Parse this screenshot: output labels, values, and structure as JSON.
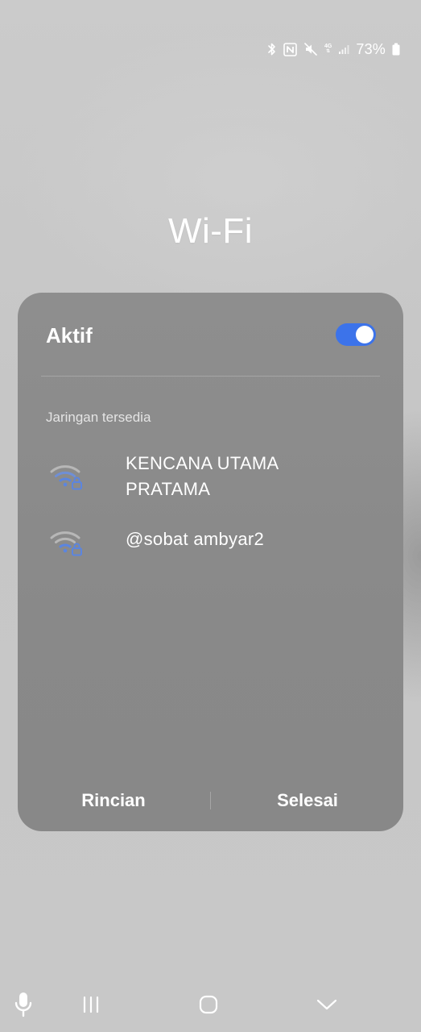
{
  "status_bar": {
    "network_type": "4G",
    "battery_percent": "73%",
    "icons": [
      "bluetooth-icon",
      "nfc-icon",
      "mute-icon",
      "signal-icon",
      "battery-icon"
    ]
  },
  "title": "Wi-Fi",
  "panel": {
    "toggle_label": "Aktif",
    "toggle_on": true,
    "section_label": "Jaringan tersedia",
    "networks": [
      {
        "name": "KENCANA UTAMA PRATAMA",
        "secured": true,
        "icon": "wifi-lock-icon"
      },
      {
        "name": "@sobat ambyar2",
        "secured": true,
        "icon": "wifi-lock-icon"
      }
    ],
    "buttons": {
      "details": "Rincian",
      "done": "Selesai"
    }
  },
  "nav_bar": {
    "icons": [
      "microphone-icon",
      "recents-icon",
      "home-icon",
      "back-chevron-icon"
    ]
  },
  "colors": {
    "accent": "#3c73ea",
    "wifi_icon": "#5b85e0",
    "panel": "#8b8b8b",
    "background": "#c8c8c8"
  }
}
